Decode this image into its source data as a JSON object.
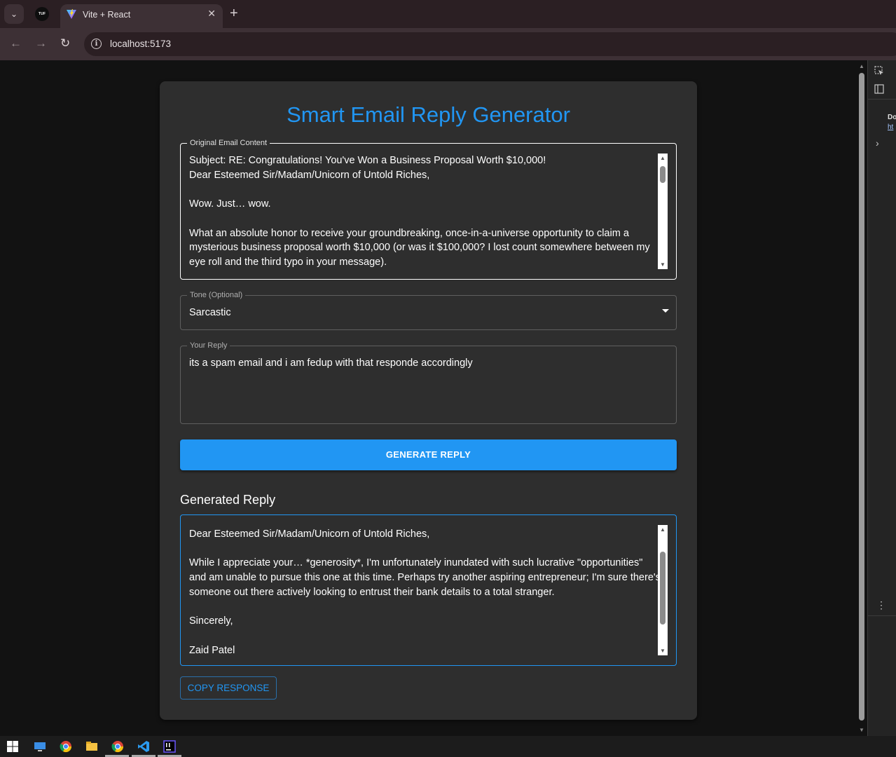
{
  "browser": {
    "tab_title": "Vite + React",
    "tab_close": "✕",
    "new_tab": "+",
    "tab_list": "⌄",
    "tuf_favicon": "TUF",
    "url": "localhost:5173",
    "back": "←",
    "forward": "→",
    "reload": "↻",
    "info": "i"
  },
  "devtools": {
    "text": "Do",
    "link": "ht",
    "chevron": "›",
    "menu": "⋮"
  },
  "app": {
    "title": "Smart Email Reply Generator",
    "original_email": {
      "label": "Original Email Content",
      "value": "Subject: RE: Congratulations! You've Won a Business Proposal Worth $10,000!\nDear Esteemed Sir/Madam/Unicorn of Untold Riches,\n\nWow. Just… wow.\n\nWhat an absolute honor to receive your groundbreaking, once-in-a-universe opportunity to claim a\nmysterious business proposal worth $10,000 (or was it $100,000? I lost count somewhere between my\neye roll and the third typo in your message)."
    },
    "tone": {
      "label": "Tone (Optional)",
      "value": "Sarcastic"
    },
    "your_reply": {
      "label": "Your Reply",
      "value": "its a spam email and i am fedup with that responde accordingly"
    },
    "generate_button": "GENERATE REPLY",
    "generated_title": "Generated Reply",
    "generated_reply": "Dear Esteemed Sir/Madam/Unicorn of Untold Riches,\n\nWhile I appreciate your… *generosity*, I'm unfortunately inundated with such lucrative \"opportunities\"\nand am unable to pursue this one at this time. Perhaps try another aspiring entrepreneur; I'm sure there's\nsomeone out there actively looking to entrust their bank details to a total stranger.\n\nSincerely,\n\nZaid Patel",
    "copy_button": "COPY RESPONSE"
  },
  "scroll": {
    "up": "▲",
    "down": "▼"
  },
  "colors": {
    "accent": "#2196f3",
    "card": "#2e2e2e",
    "page_bg": "#121212"
  }
}
